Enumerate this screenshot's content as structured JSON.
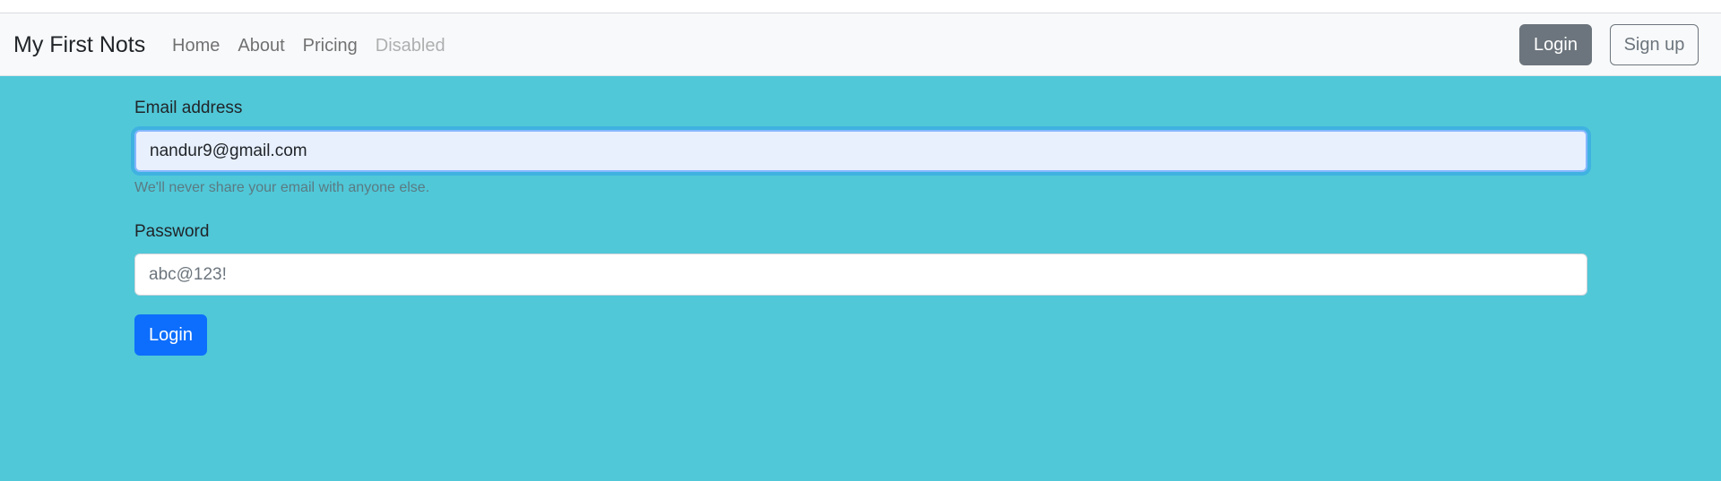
{
  "navbar": {
    "brand": "My First Nots",
    "links": [
      {
        "label": "Home"
      },
      {
        "label": "About"
      },
      {
        "label": "Pricing"
      },
      {
        "label": "Disabled"
      }
    ],
    "login_label": "Login",
    "signup_label": "Sign up"
  },
  "form": {
    "email_label": "Email address",
    "email_value": "nandur9@gmail.com",
    "email_help": "We'll never share your email with anyone else.",
    "password_label": "Password",
    "password_placeholder": "abc@123!",
    "submit_label": "Login"
  },
  "colors": {
    "page_background": "#50c8d8",
    "navbar_background": "#f8f9fa",
    "primary": "#0d6efd",
    "secondary": "#6c757d"
  }
}
